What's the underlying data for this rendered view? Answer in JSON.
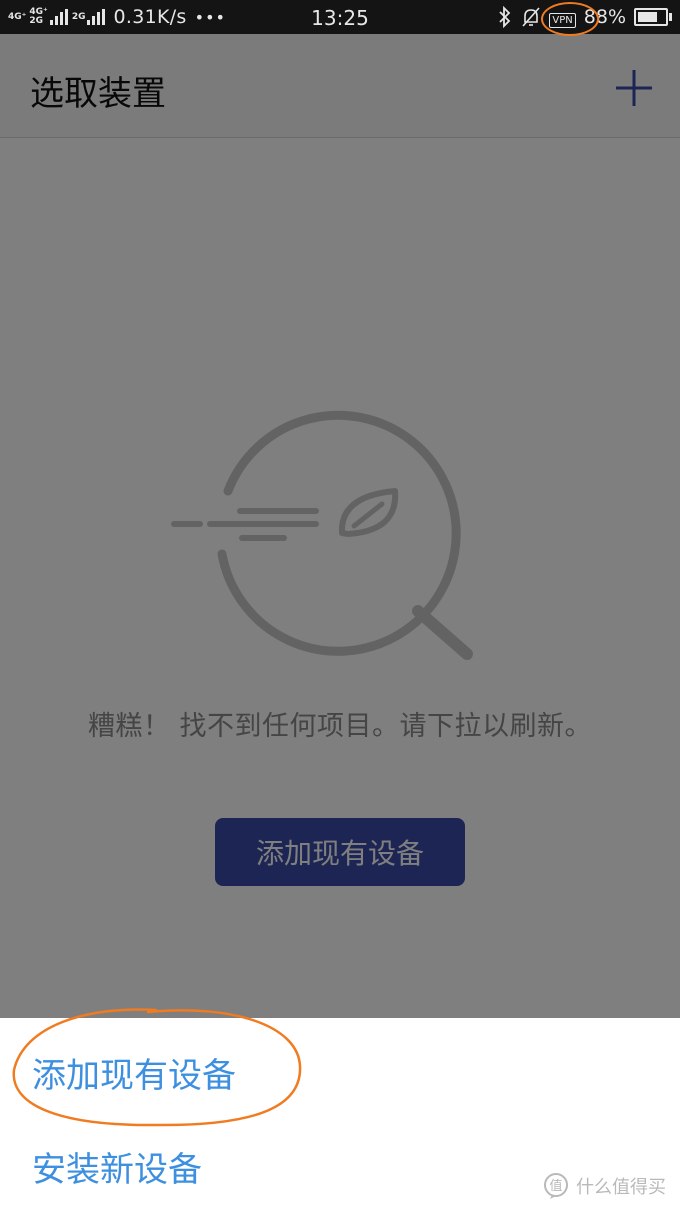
{
  "status_bar": {
    "net1": "4G⁺",
    "net2a": "4G⁺",
    "net2b": "2G",
    "net3": "2G",
    "speed": "0.31K/s",
    "more": "•••",
    "time": "13:25",
    "vpn": "VPN",
    "battery": "88%",
    "battery_level": 0.88
  },
  "header": {
    "title": "选取装置",
    "add_icon": "plus-icon"
  },
  "empty_state": {
    "icon": "magnifier-leaf-icon",
    "message": "糟糕！ 找不到任何项目。请下拉以刷新。",
    "button_label": "添加现有设备"
  },
  "action_sheet": {
    "items": [
      {
        "label": "添加现有设备"
      },
      {
        "label": "安装新设备"
      }
    ]
  },
  "watermark": {
    "text": "什么值得买",
    "logo_text": "值"
  },
  "colors": {
    "accent": "#3a4aa8",
    "sheet_text": "#3d8fe0",
    "annotation": "#f07b20"
  }
}
